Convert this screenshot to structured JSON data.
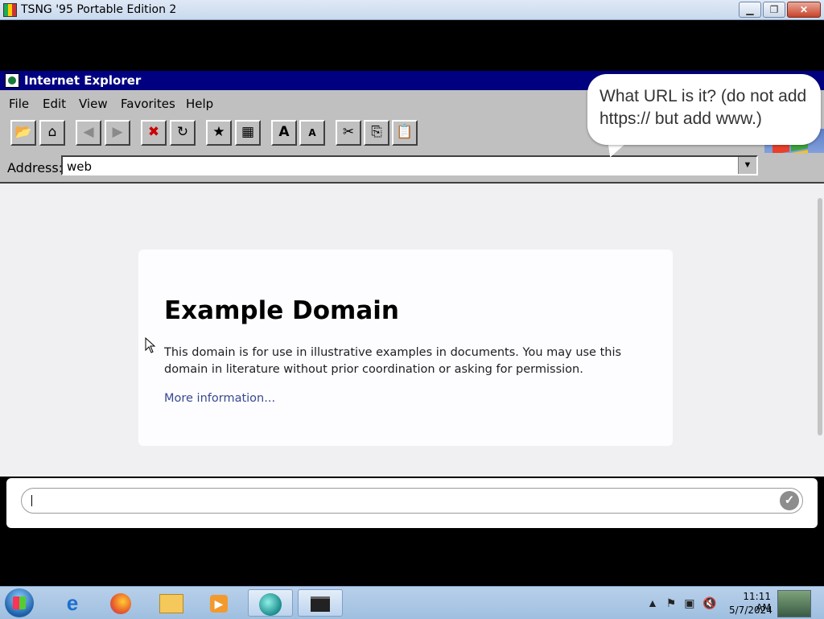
{
  "outer_window": {
    "title": "TSNG '95 Portable Edition 2",
    "buttons": {
      "minimize": "▁",
      "restore": "❐",
      "close": "✕"
    }
  },
  "ie": {
    "title": "Internet Explorer",
    "menu": [
      "File",
      "Edit",
      "View",
      "Favorites",
      "Help"
    ],
    "address_label": "Address:",
    "address_value": "web"
  },
  "bubble": {
    "text": "What URL is it? (do not add https:// but add www.)"
  },
  "page": {
    "heading": "Example Domain",
    "body": "This domain is for use in illustrative examples in documents. You may use this domain in literature without prior coordination or asking for permission.",
    "link": "More information..."
  },
  "answer": {
    "value": ""
  },
  "taskbar": {
    "apps": [
      "Internet Explorer",
      "Firefox",
      "File Explorer",
      "Media Player",
      "TSNG",
      "Game Window"
    ],
    "time": "11:11 AM",
    "date": "5/7/2024"
  }
}
